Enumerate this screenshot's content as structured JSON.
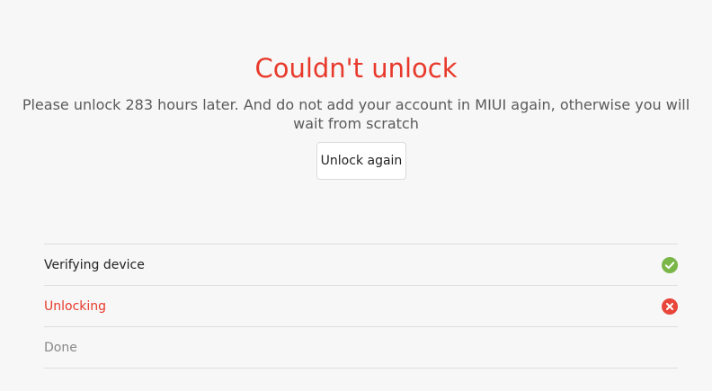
{
  "result": {
    "title": "Couldn't unlock",
    "message": "Please unlock 283 hours later. And do not add your account in MIUI again, otherwise you will wait from scratch",
    "retry_button": "Unlock again"
  },
  "steps": [
    {
      "label": "Verifying device",
      "status": "success",
      "icon": "check-circle-icon",
      "color": "#7ab648"
    },
    {
      "label": "Unlocking",
      "status": "failed",
      "icon": "x-circle-icon",
      "color": "#e8463b"
    },
    {
      "label": "Done",
      "status": "pending",
      "icon": "",
      "color": "#888888"
    }
  ],
  "colors": {
    "accent_error": "#e8392b",
    "success": "#7ab648",
    "background": "#f7f7f7"
  }
}
